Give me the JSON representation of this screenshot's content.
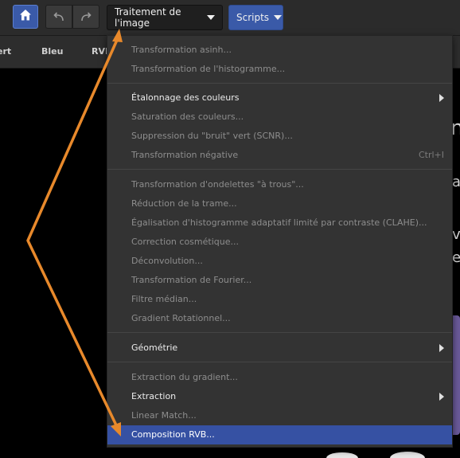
{
  "toolbar": {
    "home_icon": "home-icon",
    "undo_icon": "undo-icon",
    "redo_icon": "redo-icon",
    "image_processing_label": "Traitement de l'image",
    "scripts_label": "Scripts"
  },
  "tabs": [
    "ert",
    "Bleu",
    "RVB"
  ],
  "background_fragments": [
    "n",
    "a",
    "v",
    "e"
  ],
  "menu": {
    "items": [
      {
        "label": "Transformation asinh...",
        "enabled": false
      },
      {
        "label": "Transformation de l'histogramme...",
        "enabled": false
      },
      {
        "label": "Étalonnage des couleurs",
        "enabled": true,
        "submenu": true
      },
      {
        "label": "Saturation des couleurs...",
        "enabled": false
      },
      {
        "label": "Suppression du \"bruit\" vert (SCNR)...",
        "enabled": false
      },
      {
        "label": "Transformation négative",
        "enabled": false,
        "shortcut": "Ctrl+I"
      },
      {
        "label": "Transformation d'ondelettes \"à trous\"...",
        "enabled": false
      },
      {
        "label": "Réduction de la trame...",
        "enabled": false
      },
      {
        "label": "Égalisation d'histogramme adaptatif limité par contraste (CLAHE)...",
        "enabled": false
      },
      {
        "label": "Correction cosmétique...",
        "enabled": false
      },
      {
        "label": "Déconvolution...",
        "enabled": false
      },
      {
        "label": "Transformation de Fourier...",
        "enabled": false
      },
      {
        "label": "Filtre médian...",
        "enabled": false
      },
      {
        "label": "Gradient Rotationnel...",
        "enabled": false
      },
      {
        "label": "Géométrie",
        "enabled": true,
        "submenu": true
      },
      {
        "label": "Extraction du gradient...",
        "enabled": false
      },
      {
        "label": "Extraction",
        "enabled": true,
        "submenu": true
      },
      {
        "label": "Linear Match...",
        "enabled": false
      },
      {
        "label": "Composition RVB...",
        "enabled": true,
        "highlighted": true
      }
    ]
  },
  "colors": {
    "accent": "#3a5aa8",
    "highlight": "#3651a3",
    "annotation_arrow": "#e8892b",
    "menu_bg": "#333333"
  }
}
